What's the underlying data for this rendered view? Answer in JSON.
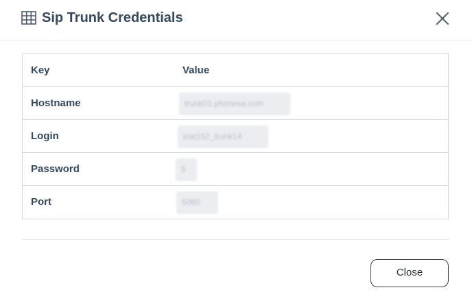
{
  "dialog": {
    "title": "Sip Trunk Credentials",
    "title_icon": "table-grid-icon",
    "close_icon": "close-icon"
  },
  "table": {
    "columns": [
      "Key",
      "Value"
    ],
    "rows": [
      {
        "key": "Hostname",
        "value": "trunk01.phonesa.com"
      },
      {
        "key": "Login",
        "value": "inst152_trunk14"
      },
      {
        "key": "Password",
        "value": "5"
      },
      {
        "key": "Port",
        "value": "5060"
      }
    ]
  },
  "footer": {
    "close_label": "Close"
  },
  "colors": {
    "title": "#34495e",
    "border": "#d6dae0",
    "masked_value_bg": "#ebedf0"
  }
}
